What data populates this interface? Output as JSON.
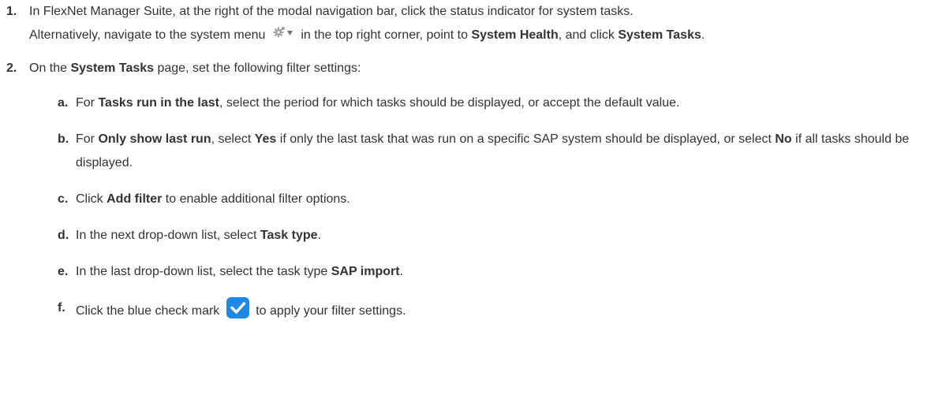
{
  "steps": [
    {
      "number": "1.",
      "line1": "In FlexNet Manager Suite, at the right of the modal navigation bar, click the status indicator for system tasks.",
      "line2_before": "Alternatively, navigate to the system menu",
      "line2_after": "in the top right corner, point to",
      "system_health": "System Health",
      "and_click": ", and click",
      "system_tasks": "System Tasks",
      "period": "."
    },
    {
      "number": "2.",
      "before": "On the",
      "system_tasks": "System Tasks",
      "after": "page, set the following filter settings:"
    }
  ],
  "substeps": [
    {
      "letter": "a.",
      "t1": "For",
      "b1": "Tasks run in the last",
      "t2": ", select the period for which tasks should be displayed, or accept the default value."
    },
    {
      "letter": "b.",
      "t1": "For",
      "b1": "Only show last run",
      "t2": ", select",
      "b2": "Yes",
      "t3": "if only the last task that was run on a specific SAP system should be displayed, or select",
      "b3": "No",
      "t4": "if all tasks should be displayed."
    },
    {
      "letter": "c.",
      "t1": "Click",
      "b1": "Add filter",
      "t2": "to enable additional filter options."
    },
    {
      "letter": "d.",
      "t1": "In the next drop-down list, select",
      "b1": "Task type",
      "t2": "."
    },
    {
      "letter": "e.",
      "t1": "In the last drop-down list, select the task type",
      "b1": "SAP import",
      "t2": "."
    },
    {
      "letter": "f.",
      "t1": "Click the blue check mark",
      "t2": "to apply your filter settings."
    }
  ],
  "icons": {
    "system_menu": "gear-dropdown-icon",
    "apply_filter": "blue-check-icon"
  },
  "colors": {
    "text": "#333333",
    "check_blue": "#1e88e5",
    "gear_gray": "#a0a0a0"
  }
}
